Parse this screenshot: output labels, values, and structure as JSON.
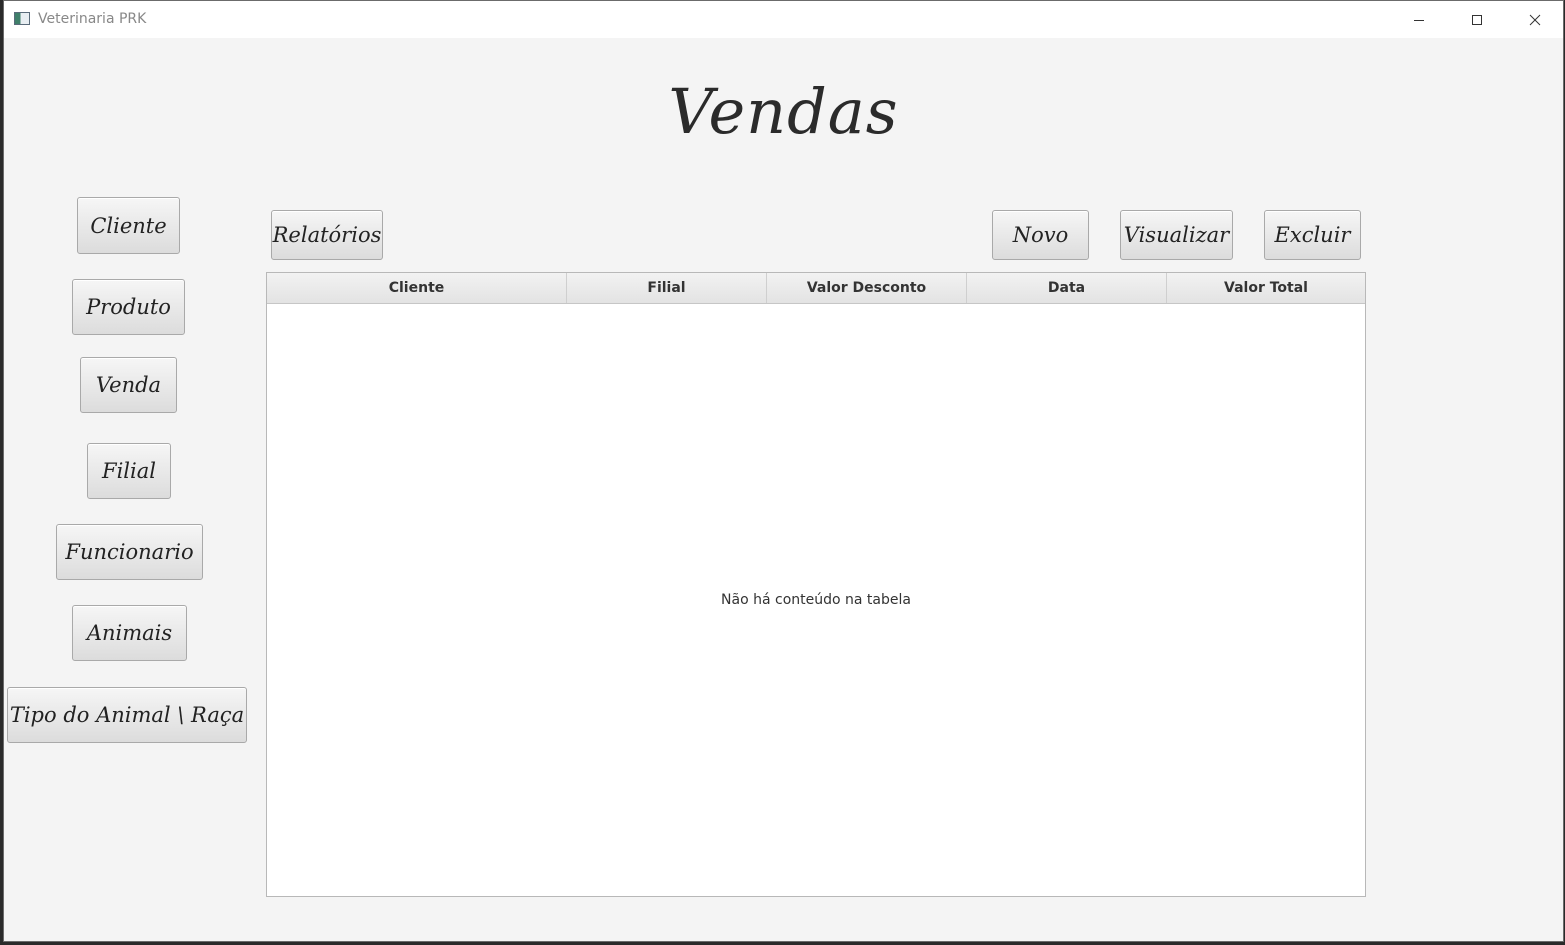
{
  "window": {
    "title": "Veterinaria PRK"
  },
  "page": {
    "title": "Vendas"
  },
  "sidebar": {
    "items": [
      {
        "label": "Cliente"
      },
      {
        "label": "Produto"
      },
      {
        "label": "Venda"
      },
      {
        "label": "Filial"
      },
      {
        "label": "Funcionario"
      },
      {
        "label": "Animais"
      },
      {
        "label": "Tipo do Animal \\ Raça"
      }
    ]
  },
  "toolbar": {
    "reports_label": "Relatórios",
    "new_label": "Novo",
    "view_label": "Visualizar",
    "delete_label": "Excluir"
  },
  "table": {
    "columns": [
      "Cliente",
      "Filial",
      "Valor Desconto",
      "Data",
      "Valor Total"
    ],
    "rows": [],
    "empty_message": "Não há conteúdo na tabela"
  },
  "icons": {
    "app": "app-icon",
    "minimize": "minimize-icon",
    "maximize": "maximize-icon",
    "close": "close-icon"
  }
}
